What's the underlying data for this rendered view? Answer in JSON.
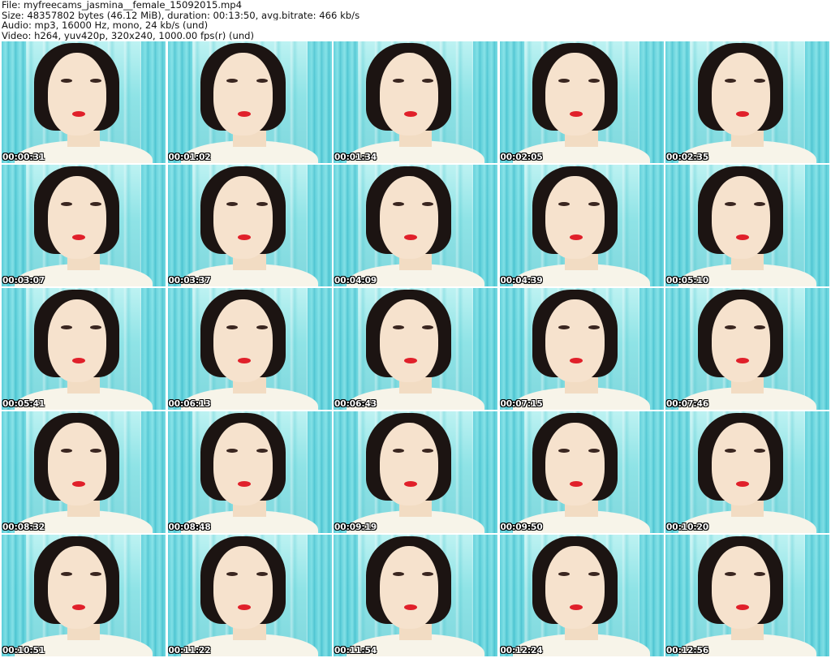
{
  "header": {
    "file_line": "File: myfreecams_jasmina__female_15092015.mp4",
    "size_line": "Size: 48357802 bytes (46.12 MiB), duration: 00:13:50, avg.bitrate: 466 kb/s",
    "audio_line": "Audio: mp3, 16000 Hz, mono, 24 kb/s (und)",
    "video_line": "Video: h264, yuv420p, 320x240, 1000.00 fps(r) (und)"
  },
  "thumbnails": [
    {
      "timestamp": "00:00:31"
    },
    {
      "timestamp": "00:01:02"
    },
    {
      "timestamp": "00:01:34"
    },
    {
      "timestamp": "00:02:05"
    },
    {
      "timestamp": "00:02:35"
    },
    {
      "timestamp": "00:03:07"
    },
    {
      "timestamp": "00:03:37"
    },
    {
      "timestamp": "00:04:09"
    },
    {
      "timestamp": "00:04:39"
    },
    {
      "timestamp": "00:05:10"
    },
    {
      "timestamp": "00:05:41"
    },
    {
      "timestamp": "00:06:13"
    },
    {
      "timestamp": "00:06:43"
    },
    {
      "timestamp": "00:07:15"
    },
    {
      "timestamp": "00:07:46"
    },
    {
      "timestamp": "00:08:32"
    },
    {
      "timestamp": "00:08:48"
    },
    {
      "timestamp": "00:09:19"
    },
    {
      "timestamp": "00:09:50"
    },
    {
      "timestamp": "00:10:20"
    },
    {
      "timestamp": "00:10:51"
    },
    {
      "timestamp": "00:11:22"
    },
    {
      "timestamp": "00:11:54"
    },
    {
      "timestamp": "00:12:24"
    },
    {
      "timestamp": "00:12:56"
    }
  ]
}
